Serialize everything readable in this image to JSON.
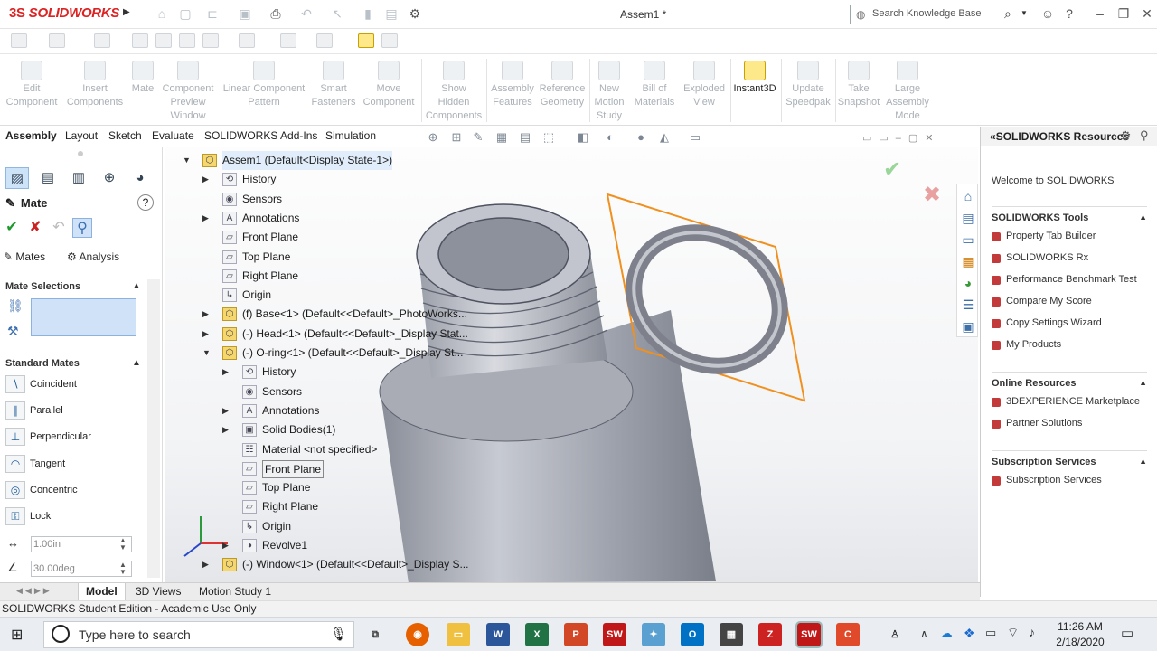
{
  "app": {
    "logo_text": "SOLIDWORKS",
    "logo_mark": "3S",
    "doc_title": "Assem1 *"
  },
  "search": {
    "placeholder": "Search Knowledge Base"
  },
  "window": {
    "help": "?"
  },
  "command_manager": {
    "buttons": [
      {
        "label": "Edit\nComponent"
      },
      {
        "label": "Insert\nComponents"
      },
      {
        "label": "Mate"
      },
      {
        "label": "Component\nPreview\nWindow"
      },
      {
        "label": "Linear Component\nPattern"
      },
      {
        "label": "Smart\nFasteners"
      },
      {
        "label": "Move\nComponent"
      },
      {
        "label": "Show\nHidden\nComponents"
      },
      {
        "label": "Assembly\nFeatures"
      },
      {
        "label": "Reference\nGeometry"
      },
      {
        "label": "New\nMotion\nStudy"
      },
      {
        "label": "Bill of\nMaterials"
      },
      {
        "label": "Exploded\nView"
      },
      {
        "label": "Instant3D"
      },
      {
        "label": "Update\nSpeedpak"
      },
      {
        "label": "Take\nSnapshot"
      },
      {
        "label": "Large\nAssembly\nMode"
      }
    ]
  },
  "tabs": [
    "Assembly",
    "Layout",
    "Sketch",
    "Evaluate",
    "SOLIDWORKS Add-Ins",
    "Simulation"
  ],
  "property_manager": {
    "title": "Mate",
    "mates_tab": "Mates",
    "analysis_tab": "Analysis",
    "mate_selections": "Mate Selections",
    "standard_mates": "Standard Mates",
    "mate_types": [
      "Coincident",
      "Parallel",
      "Perpendicular",
      "Tangent",
      "Concentric",
      "Lock"
    ],
    "distance_value": "1.00in",
    "angle_value": "30.00deg",
    "help": "?"
  },
  "tree": {
    "nodes": [
      {
        "label": "Assem1  (Default<Display State-1>)",
        "indent": 0,
        "expanded": true
      },
      {
        "label": "History",
        "indent": 1,
        "collapsed": true
      },
      {
        "label": "Sensors",
        "indent": 1
      },
      {
        "label": "Annotations",
        "indent": 1,
        "collapsed": true
      },
      {
        "label": "Front Plane",
        "indent": 1
      },
      {
        "label": "Top Plane",
        "indent": 1
      },
      {
        "label": "Right Plane",
        "indent": 1
      },
      {
        "label": "Origin",
        "indent": 1
      },
      {
        "label": "(f) Base<1> (Default<<Default>_PhotoWorks...",
        "indent": 1,
        "collapsed": true
      },
      {
        "label": "(-) Head<1> (Default<<Default>_Display Stat...",
        "indent": 1,
        "collapsed": true
      },
      {
        "label": "(-) O-ring<1> (Default<<Default>_Display St...",
        "indent": 1,
        "expanded": true
      },
      {
        "label": "History",
        "indent": 2,
        "collapsed": true
      },
      {
        "label": "Sensors",
        "indent": 2
      },
      {
        "label": "Annotations",
        "indent": 2,
        "collapsed": true
      },
      {
        "label": "Solid Bodies(1)",
        "indent": 2,
        "collapsed": true
      },
      {
        "label": "Material <not specified>",
        "indent": 2
      },
      {
        "label": "Front Plane",
        "indent": 2,
        "selected": true
      },
      {
        "label": "Top Plane",
        "indent": 2
      },
      {
        "label": "Right Plane",
        "indent": 2
      },
      {
        "label": "Origin",
        "indent": 2
      },
      {
        "label": "Revolve1",
        "indent": 2,
        "collapsed": true
      },
      {
        "label": "(-) Window<1> (Default<<Default>_Display S...",
        "indent": 1,
        "collapsed": true
      }
    ]
  },
  "resources": {
    "header": "SOLIDWORKS Resources",
    "welcome": "Welcome to SOLIDWORKS",
    "tools_title": "SOLIDWORKS Tools",
    "tools": [
      "Property Tab Builder",
      "SOLIDWORKS Rx",
      "Performance Benchmark Test",
      "Compare My Score",
      "Copy Settings Wizard",
      "My Products"
    ],
    "online_title": "Online Resources",
    "online": [
      "3DEXPERIENCE Marketplace",
      "Partner Solutions"
    ],
    "subscription_title": "Subscription Services",
    "subscription": [
      "Subscription Services"
    ]
  },
  "bottom_tabs": [
    "Model",
    "3D Views",
    "Motion Study 1"
  ],
  "status_text": "SOLIDWORKS Student Edition - Academic Use Only",
  "taskbar": {
    "search_placeholder": "Type here to search",
    "time": "11:26 AM",
    "date": "2/18/2020"
  },
  "colors": {
    "selection_plane": "#f0901f",
    "ring": "#8a8d96",
    "accent": "#1f6fc4"
  }
}
